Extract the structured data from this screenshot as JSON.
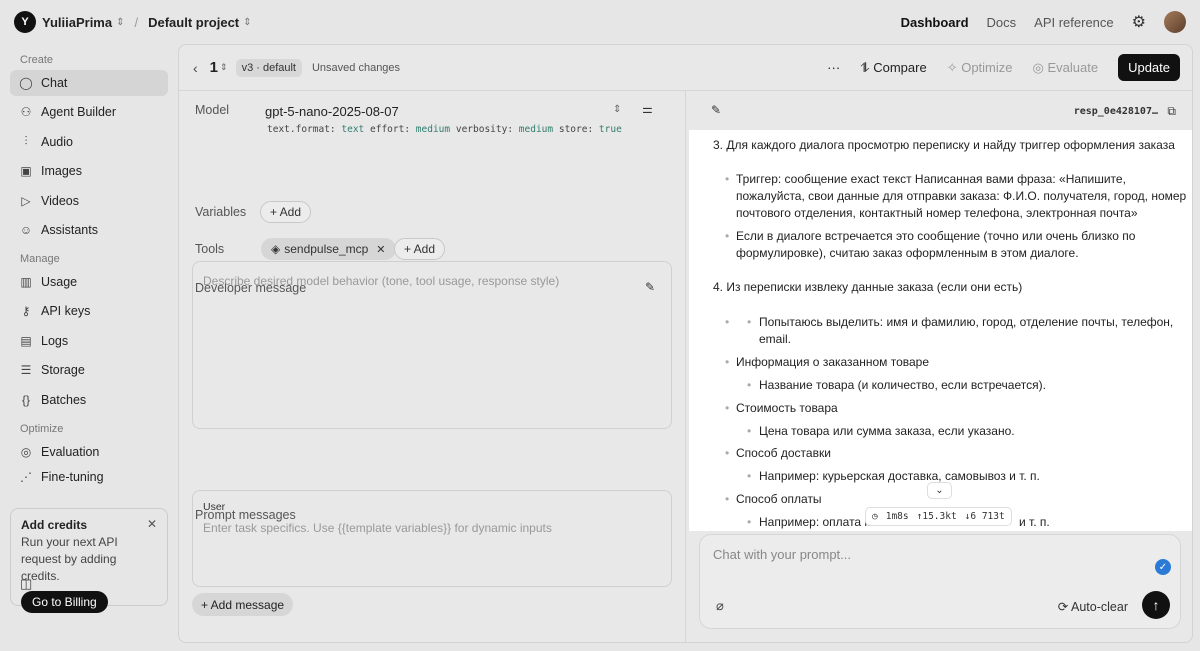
{
  "topbar": {
    "org_initial": "Y",
    "org_name": "YuliiaPrima",
    "separator": "/",
    "project": "Default project",
    "nav": [
      "Dashboard",
      "Docs",
      "API reference"
    ]
  },
  "sidebar": {
    "sections": {
      "create": "Create",
      "manage": "Manage",
      "optimize": "Optimize"
    },
    "create_items": [
      {
        "label": "Chat",
        "icon": "chat-icon"
      },
      {
        "label": "Agent Builder",
        "icon": "agent-builder-icon"
      },
      {
        "label": "Audio",
        "icon": "audio-icon"
      },
      {
        "label": "Images",
        "icon": "images-icon"
      },
      {
        "label": "Videos",
        "icon": "videos-icon"
      },
      {
        "label": "Assistants",
        "icon": "assistants-icon"
      }
    ],
    "manage_items": [
      {
        "label": "Usage",
        "icon": "usage-icon"
      },
      {
        "label": "API keys",
        "icon": "key-icon"
      },
      {
        "label": "Logs",
        "icon": "logs-icon"
      },
      {
        "label": "Storage",
        "icon": "storage-icon"
      },
      {
        "label": "Batches",
        "icon": "batches-icon"
      }
    ],
    "optimize_items": [
      {
        "label": "Evaluation",
        "icon": "evaluation-icon"
      },
      {
        "label": "Fine-tuning",
        "icon": "fine-tuning-icon"
      }
    ],
    "credits": {
      "title": "Add credits",
      "text": "Run your next API request by adding credits.",
      "button": "Go to Billing"
    }
  },
  "header": {
    "version": "1",
    "badge": "v3 · default",
    "status": "Unsaved changes",
    "more": "···",
    "compare": "Compare",
    "optimize": "Optimize",
    "evaluate": "Evaluate",
    "update": "Update"
  },
  "config": {
    "model_label": "Model",
    "model_name": "gpt-5-nano-2025-08-07",
    "params": [
      {
        "key": "text.format:",
        "value": "text"
      },
      {
        "key": "effort:",
        "value": "medium"
      },
      {
        "key": "verbosity:",
        "value": "medium"
      },
      {
        "key": "store:",
        "value": "true"
      }
    ],
    "variables_label": "Variables",
    "add": "+ Add",
    "tools_label": "Tools",
    "tool_name": "sendpulse_mcp",
    "developer_label": "Developer message",
    "developer_placeholder": "Describe desired model behavior (tone, tool usage, response style)",
    "prompt_label": "Prompt messages",
    "user_role": "User",
    "user_placeholder": "Enter task specifics. Use {{template variables}} for dynamic inputs",
    "add_message": "+ Add message"
  },
  "response": {
    "id": "resp_0e428107…",
    "lines": [
      "3. Для каждого диалога просмотрю переписку и найду триггер оформления заказа",
      "Триггер: сообщение exact текст Написанная вами фраза: «Напишите,",
      "пожалуйста, свои данные для отправки заказа: Ф.И.О. получателя, город, номер",
      "почтового отделения, контактный номер телефона, электронная почта»",
      "Если в диалоге встречается это сообщение (точно или очень близко по",
      "формулировке), считаю заказ оформленным в этом диалоге.",
      "4. Из переписки извлеку данные заказа (если они есть)",
      "Попытаюсь выделить: имя и фамилию, город, отделение почты, телефон,",
      "email.",
      "Информация о заказанном товаре",
      "Название товара (и количество, если встречается).",
      "Стоимость товара",
      "Цена товара или сумма заказа, если указано.",
      "Способ доставки",
      "Например: курьерская доставка, самовывоз и т. п.",
      "Способ оплаты",
      "Например: оплата ка",
      "и т. п."
    ],
    "stats": {
      "time": "1m8s",
      "input": "↑15.3kt",
      "output": "↓6 713t"
    }
  },
  "chat": {
    "placeholder": "Chat with your prompt...",
    "autoclear": "Auto-clear"
  }
}
